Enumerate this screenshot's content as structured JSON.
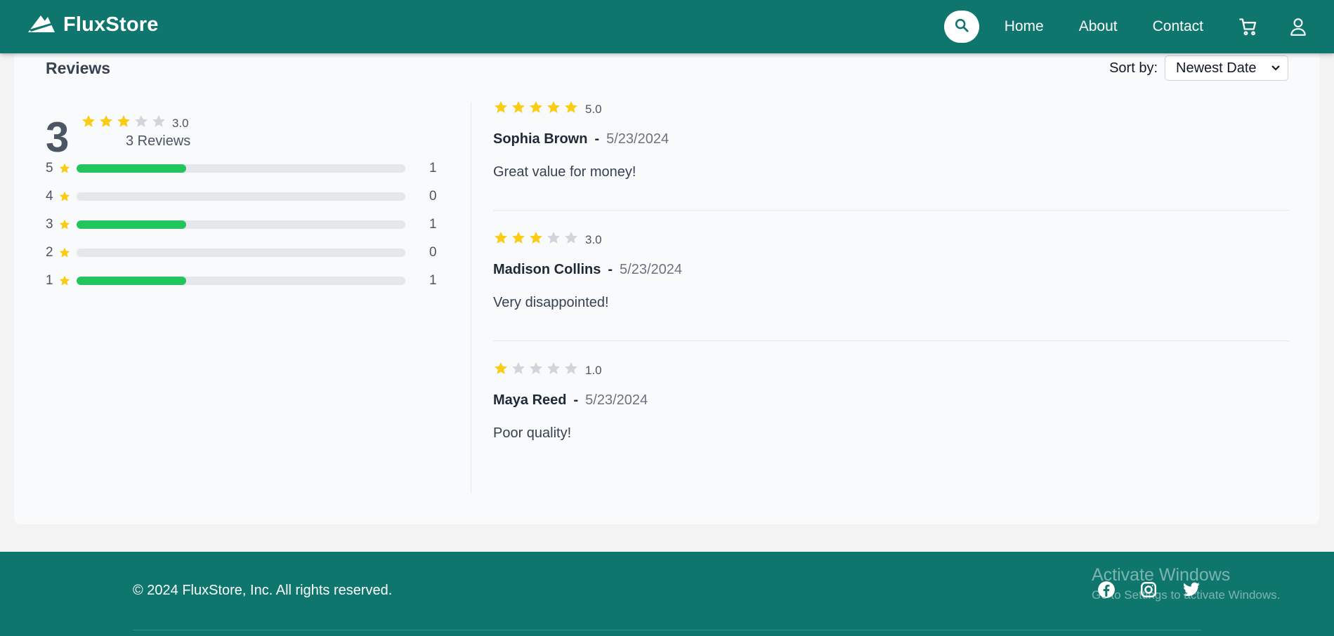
{
  "header": {
    "brand": "FluxStore",
    "nav": [
      "Home",
      "About",
      "Contact"
    ],
    "icons": [
      "search-icon",
      "cart-icon",
      "user-icon"
    ]
  },
  "reviews": {
    "title": "Reviews",
    "sort_label": "Sort by:",
    "sort_value": "Newest Date",
    "summary": {
      "average_big": "3",
      "average_rating": 3.0,
      "average_label": "3.0",
      "count_text": "3 Reviews"
    },
    "distribution": [
      {
        "stars": "5",
        "count": "1",
        "fraction": 0.333
      },
      {
        "stars": "4",
        "count": "0",
        "fraction": 0
      },
      {
        "stars": "3",
        "count": "1",
        "fraction": 0.333
      },
      {
        "stars": "2",
        "count": "0",
        "fraction": 0
      },
      {
        "stars": "1",
        "count": "1",
        "fraction": 0.333
      }
    ],
    "items": [
      {
        "rating": 5,
        "rating_label": "5.0",
        "name": "Sophia Brown",
        "separator": "-",
        "date": "5/23/2024",
        "text": "Great value for money!"
      },
      {
        "rating": 3,
        "rating_label": "3.0",
        "name": "Madison Collins",
        "separator": "-",
        "date": "5/23/2024",
        "text": "Very disappointed!"
      },
      {
        "rating": 1,
        "rating_label": "1.0",
        "name": "Maya Reed",
        "separator": "-",
        "date": "5/23/2024",
        "text": "Poor quality!"
      }
    ]
  },
  "footer": {
    "copyright": "© 2024 FluxStore, Inc. All rights reserved.",
    "socials": [
      "facebook-icon",
      "instagram-icon",
      "twitter-icon"
    ]
  },
  "watermark": {
    "title": "Activate Windows",
    "subtitle": "Go to Settings to activate Windows."
  },
  "colors": {
    "primary": "#0f766e",
    "star_filled": "#facc15",
    "star_empty": "#d1d5db",
    "bar_fill": "#22c55e",
    "bar_track": "#e5e7eb"
  }
}
